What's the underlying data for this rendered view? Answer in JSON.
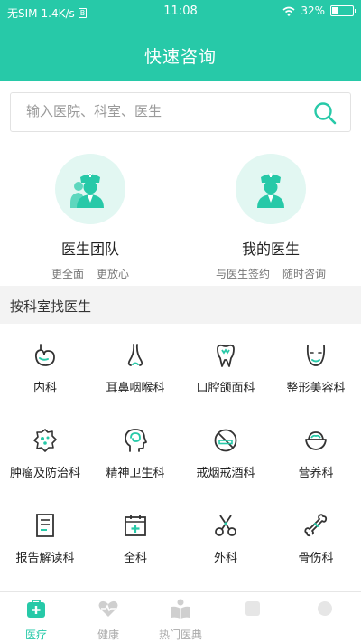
{
  "status_bar": {
    "carrier": "无SIM",
    "speed": "1.4K/s",
    "sim_badge": "B",
    "time": "11:08",
    "battery": "32%",
    "battery_level": 0.32
  },
  "header": {
    "title": "快速咨询"
  },
  "search": {
    "placeholder": "输入医院、科室、医生"
  },
  "doctor_options": [
    {
      "title": "医生团队",
      "tags": [
        "更全面",
        "更放心"
      ],
      "icon": "doctor-team-icon"
    },
    {
      "title": "我的医生",
      "tags": [
        "与医生签约",
        "随时咨询"
      ],
      "icon": "my-doctor-icon"
    }
  ],
  "section": {
    "title": "按科室找医生"
  },
  "departments": [
    {
      "label": "内科",
      "icon": "stomach-icon"
    },
    {
      "label": "耳鼻咽喉科",
      "icon": "nose-icon"
    },
    {
      "label": "口腔颌面科",
      "icon": "tooth-icon"
    },
    {
      "label": "整形美容科",
      "icon": "face-icon"
    },
    {
      "label": "肿瘤及防治科",
      "icon": "tumor-cell-icon"
    },
    {
      "label": "精神卫生科",
      "icon": "brain-head-icon"
    },
    {
      "label": "戒烟戒酒科",
      "icon": "no-smoking-icon"
    },
    {
      "label": "营养科",
      "icon": "bowl-icon"
    },
    {
      "label": "报告解读科",
      "icon": "report-icon"
    },
    {
      "label": "全科",
      "icon": "calendar-plus-icon"
    },
    {
      "label": "外科",
      "icon": "scissors-icon"
    },
    {
      "label": "骨伤科",
      "icon": "bone-icon"
    }
  ],
  "tabs": [
    {
      "label": "医疗",
      "icon": "medical-kit-icon",
      "active": true
    },
    {
      "label": "健康",
      "icon": "heart-pulse-icon",
      "active": false
    },
    {
      "label": "热门医典",
      "icon": "book-reader-icon",
      "active": false
    },
    {
      "label": "",
      "icon": "tab-4-icon",
      "active": false
    },
    {
      "label": "",
      "icon": "tab-5-icon",
      "active": false
    }
  ],
  "colors": {
    "accent": "#27c9a8",
    "icon_circle_bg": "#e2f7f2",
    "section_bg": "#f3f3f3"
  }
}
